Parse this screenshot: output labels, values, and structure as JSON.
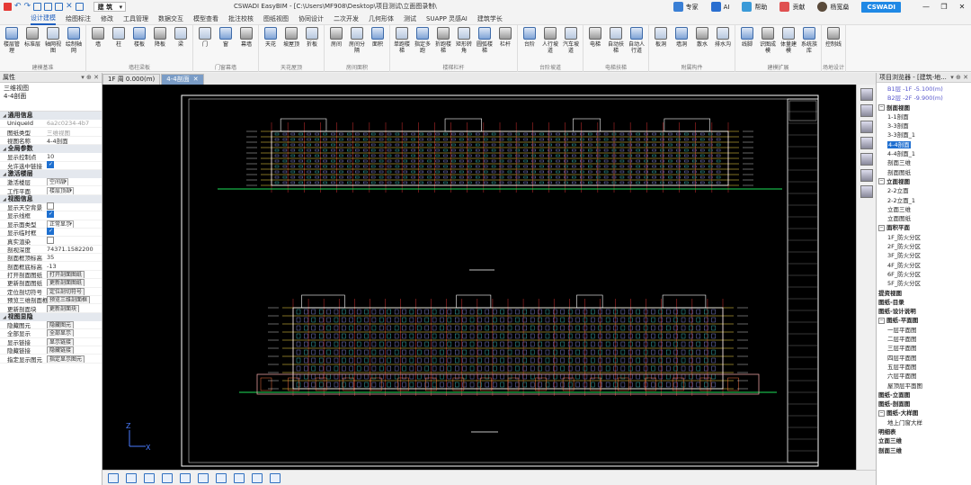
{
  "titlebar": {
    "profile": "建 筑",
    "window_title": "CSWADI EasyBIM - [C:\\Users\\MF908\\Desktop\\项目测试\\立面图录制\\",
    "buttons": [
      {
        "label": "专家",
        "icon": "cloud-icon",
        "color": "#3a7fd5"
      },
      {
        "label": "AI",
        "icon": "ai-icon",
        "color": "#2a6fd0"
      },
      {
        "label": "帮助",
        "icon": "help-icon",
        "color": "#3a9ad8"
      },
      {
        "label": "贡献",
        "icon": "heart-icon",
        "color": "#e05050"
      },
      {
        "label": "杨宽燊",
        "icon": "avatar-icon",
        "color": "#5a4a3a"
      }
    ],
    "brand": "CSWADI",
    "win_controls": [
      "—",
      "❐",
      "✕"
    ]
  },
  "menu": [
    "设计建模",
    "绘图标注",
    "修改",
    "工具管理",
    "数据交互",
    "模型查看",
    "批注校核",
    "图纸视图",
    "协同设计",
    "二次开发",
    "几何形体",
    "测试",
    "SUAPP 灵感AI",
    "建筑学长"
  ],
  "ribbon": {
    "groups": [
      {
        "label": "建模基准",
        "buttons": [
          "楼层管理",
          "标准层",
          "轴网视图",
          "绘制轴网"
        ]
      },
      {
        "label": "墙柱梁板",
        "buttons": [
          "墙",
          "柱",
          "楼板",
          "降板",
          "梁"
        ]
      },
      {
        "label": "门窗幕墙",
        "buttons": [
          "门",
          "窗",
          "幕墙"
        ]
      },
      {
        "label": "天花屋顶",
        "buttons": [
          "天花",
          "坡屋顶",
          "折板"
        ]
      },
      {
        "label": "房间面积",
        "buttons": [
          "房间",
          "房间分隔",
          "面积"
        ]
      },
      {
        "label": "楼梯栏杆",
        "buttons": [
          "单跑楼梯",
          "指定多跑",
          "折跑楼梯",
          "矩形转角",
          "圆弧楼梯",
          "栏杆"
        ]
      },
      {
        "label": "台阶坡道",
        "buttons": [
          "台阶",
          "人行坡道",
          "汽车坡道"
        ]
      },
      {
        "label": "电梯扶梯",
        "buttons": [
          "电梯",
          "自动扶梯",
          "自动人行道"
        ]
      },
      {
        "label": "附属构件",
        "buttons": [
          "板洞",
          "墙洞",
          "散水",
          "排水沟"
        ]
      },
      {
        "label": "建模扩展",
        "buttons": [
          "线脚",
          "识图成模",
          "体量建模",
          "系统族库"
        ]
      },
      {
        "label": "场地设计",
        "buttons": [
          "控制线"
        ]
      }
    ]
  },
  "left_panel": {
    "header": "属性",
    "header_controls": "▾ ⊕ ✕",
    "view_type": "三维视图",
    "view_name": "4-4剖面",
    "sections": [
      {
        "title": "通用信息",
        "rows": [
          {
            "k": "UniqueId",
            "v": "6a2c0234-4b7",
            "type": "dim"
          },
          {
            "k": "图纸类型",
            "v": "三维视图",
            "type": "dim"
          },
          {
            "k": "视图名称",
            "v": "4-4剖面",
            "type": "text"
          }
        ]
      },
      {
        "title": "全局参数",
        "rows": [
          {
            "k": "显示控制点",
            "v": "10",
            "type": "text"
          },
          {
            "k": "允许选中链接",
            "v": "",
            "type": "check_on"
          }
        ]
      },
      {
        "title": "激活楼层",
        "rows": [
          {
            "k": "激活楼层",
            "v": "空间层",
            "type": "select"
          },
          {
            "k": "工作平面",
            "v": "楼层顶部",
            "type": "select"
          }
        ]
      },
      {
        "title": "视图信息",
        "rows": [
          {
            "k": "显示天空背景",
            "v": "",
            "type": "check_off"
          },
          {
            "k": "显示线框",
            "v": "",
            "type": "check_on"
          },
          {
            "k": "显示面类型",
            "v": "正常显示",
            "type": "select"
          },
          {
            "k": "显示临时框",
            "v": "",
            "type": "check_on"
          },
          {
            "k": "真实渲染",
            "v": "",
            "type": "check_off"
          },
          {
            "k": "剖视深度",
            "v": "74371.1582200",
            "type": "text"
          },
          {
            "k": "剖面框顶标高",
            "v": "35",
            "type": "text"
          },
          {
            "k": "剖面框底标高",
            "v": "-13",
            "type": "text"
          },
          {
            "k": "打开剖面图纸",
            "v": "打开剖面图纸",
            "type": "button"
          },
          {
            "k": "更新剖面图纸",
            "v": "更新剖面图纸",
            "type": "button"
          },
          {
            "k": "定位剖切符号",
            "v": "定位剖切符号",
            "type": "button"
          },
          {
            "k": "预览三维剖面框",
            "v": "预览三维剖面框",
            "type": "button"
          },
          {
            "k": "更新剖面块",
            "v": "更新剖面块",
            "type": "button"
          }
        ]
      },
      {
        "title": "视图显隐",
        "rows": [
          {
            "k": "隐藏图元",
            "v": "隐藏图元",
            "type": "button"
          },
          {
            "k": "全部显示",
            "v": "全部显示",
            "type": "button"
          },
          {
            "k": "显示链接",
            "v": "显示链接",
            "type": "button"
          },
          {
            "k": "隐藏链接",
            "v": "隐藏链接",
            "type": "button"
          },
          {
            "k": "指定显示图元",
            "v": "指定显示图元",
            "type": "button"
          }
        ]
      }
    ]
  },
  "tabs": [
    {
      "label": "1F 周 0.000(m)",
      "active": false
    },
    {
      "label": "4-4剖面",
      "active": true,
      "close": "✕"
    }
  ],
  "drawing": {
    "label_top": "1-1立面图",
    "label_bottom": "2-2剖面图"
  },
  "right_panel": {
    "header": "项目浏览器 - [建筑-地...",
    "header_controls": "▾ ⊕ ✕",
    "items": [
      {
        "label": "B1层 -1F -5.100(m)",
        "level": 1,
        "kind": "lvl"
      },
      {
        "label": "B2层 -2F -9.900(m)",
        "level": 1,
        "kind": "lvl"
      },
      {
        "label": "剖面视图",
        "level": 0,
        "expand": "−"
      },
      {
        "label": "1-1剖面",
        "level": 1
      },
      {
        "label": "3-3剖面",
        "level": 1
      },
      {
        "label": "3-3剖面_1",
        "level": 1
      },
      {
        "label": "4-4剖面",
        "level": 1,
        "selected": true
      },
      {
        "label": "4-4剖面_1",
        "level": 1
      },
      {
        "label": "剖面三维",
        "level": 1
      },
      {
        "label": "剖面图纸",
        "level": 1
      },
      {
        "label": "立面视图",
        "level": 0,
        "expand": "−"
      },
      {
        "label": "2-2立面",
        "level": 1
      },
      {
        "label": "2-2立面_1",
        "level": 1
      },
      {
        "label": "立面三维",
        "level": 1
      },
      {
        "label": "立面图纸",
        "level": 1
      },
      {
        "label": "面积平面",
        "level": 0,
        "expand": "−"
      },
      {
        "label": "1F_防火分区",
        "level": 1
      },
      {
        "label": "2F_防火分区",
        "level": 1
      },
      {
        "label": "3F_防火分区",
        "level": 1
      },
      {
        "label": "4F_防火分区",
        "level": 1
      },
      {
        "label": "6F_防火分区",
        "level": 1
      },
      {
        "label": "5F_防火分区",
        "level": 1
      },
      {
        "label": "提资视图",
        "level": 0
      },
      {
        "label": "图纸-目录",
        "level": 0
      },
      {
        "label": "图纸-设计说明",
        "level": 0
      },
      {
        "label": "图纸-平面图",
        "level": 0,
        "expand": "−"
      },
      {
        "label": "一层平面图",
        "level": 1
      },
      {
        "label": "二层平面图",
        "level": 1
      },
      {
        "label": "三层平面图",
        "level": 1
      },
      {
        "label": "四层平面图",
        "level": 1
      },
      {
        "label": "五层平面图",
        "level": 1
      },
      {
        "label": "六层平面图",
        "level": 1
      },
      {
        "label": "屋顶层平面图",
        "level": 1
      },
      {
        "label": "图纸-立面图",
        "level": 0
      },
      {
        "label": "图纸-剖面图",
        "level": 0
      },
      {
        "label": "图纸-大样图",
        "level": 0,
        "expand": "−"
      },
      {
        "label": "地上门窗大样",
        "level": 1
      },
      {
        "label": "明细表",
        "level": 0
      },
      {
        "label": "立面三维",
        "level": 0
      },
      {
        "label": "剖面三维",
        "level": 0
      }
    ]
  },
  "colors": {
    "accent": "#1f5fbf",
    "canvas": "#000000",
    "brand": "#1f88e5"
  }
}
